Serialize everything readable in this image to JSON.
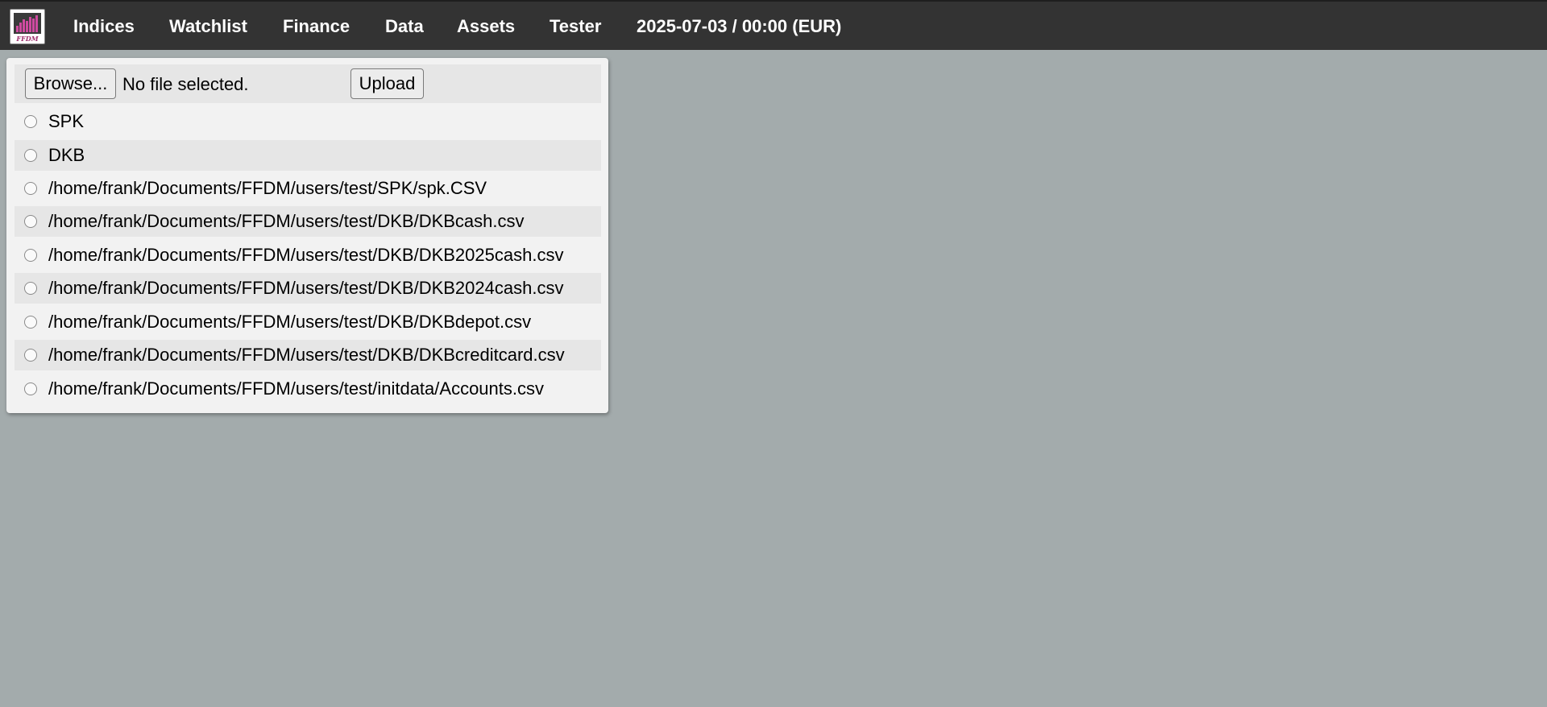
{
  "topbar": {
    "logo_text": "FFDM",
    "nav": [
      "Indices",
      "Watchlist",
      "Finance",
      "Data",
      "Assets",
      "Tester"
    ],
    "date_label": "2025-07-03 / 00:00 (EUR)"
  },
  "upload": {
    "browse_label": "Browse...",
    "file_status": "No file selected.",
    "upload_label": "Upload"
  },
  "sources": [
    "SPK",
    "DKB",
    "/home/frank/Documents/FFDM/users/test/SPK/spk.CSV",
    "/home/frank/Documents/FFDM/users/test/DKB/DKBcash.csv",
    "/home/frank/Documents/FFDM/users/test/DKB/DKB2025cash.csv",
    "/home/frank/Documents/FFDM/users/test/DKB/DKB2024cash.csv",
    "/home/frank/Documents/FFDM/users/test/DKB/DKBdepot.csv",
    "/home/frank/Documents/FFDM/users/test/DKB/DKBcreditcard.csv",
    "/home/frank/Documents/FFDM/users/test/initdata/Accounts.csv"
  ],
  "colors": {
    "topbar": "#333333",
    "background": "#a3abac",
    "panel": "#f2f2f2",
    "row_shade": "#e6e6e6"
  }
}
